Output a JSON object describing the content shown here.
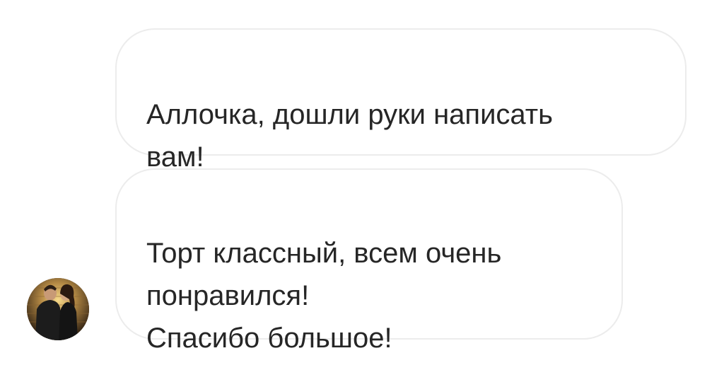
{
  "conversation": {
    "messages": [
      {
        "text": "Аллочка, дошли руки написать\nвам!"
      },
      {
        "text": "Торт классный, всем очень\nпонравился!\nСпасибо большое!"
      }
    ],
    "sender": {
      "avatar_icon": "profile-photo-couple"
    }
  },
  "colors": {
    "bubble_border": "#ececec",
    "bubble_background": "#ffffff",
    "text": "#262626"
  }
}
